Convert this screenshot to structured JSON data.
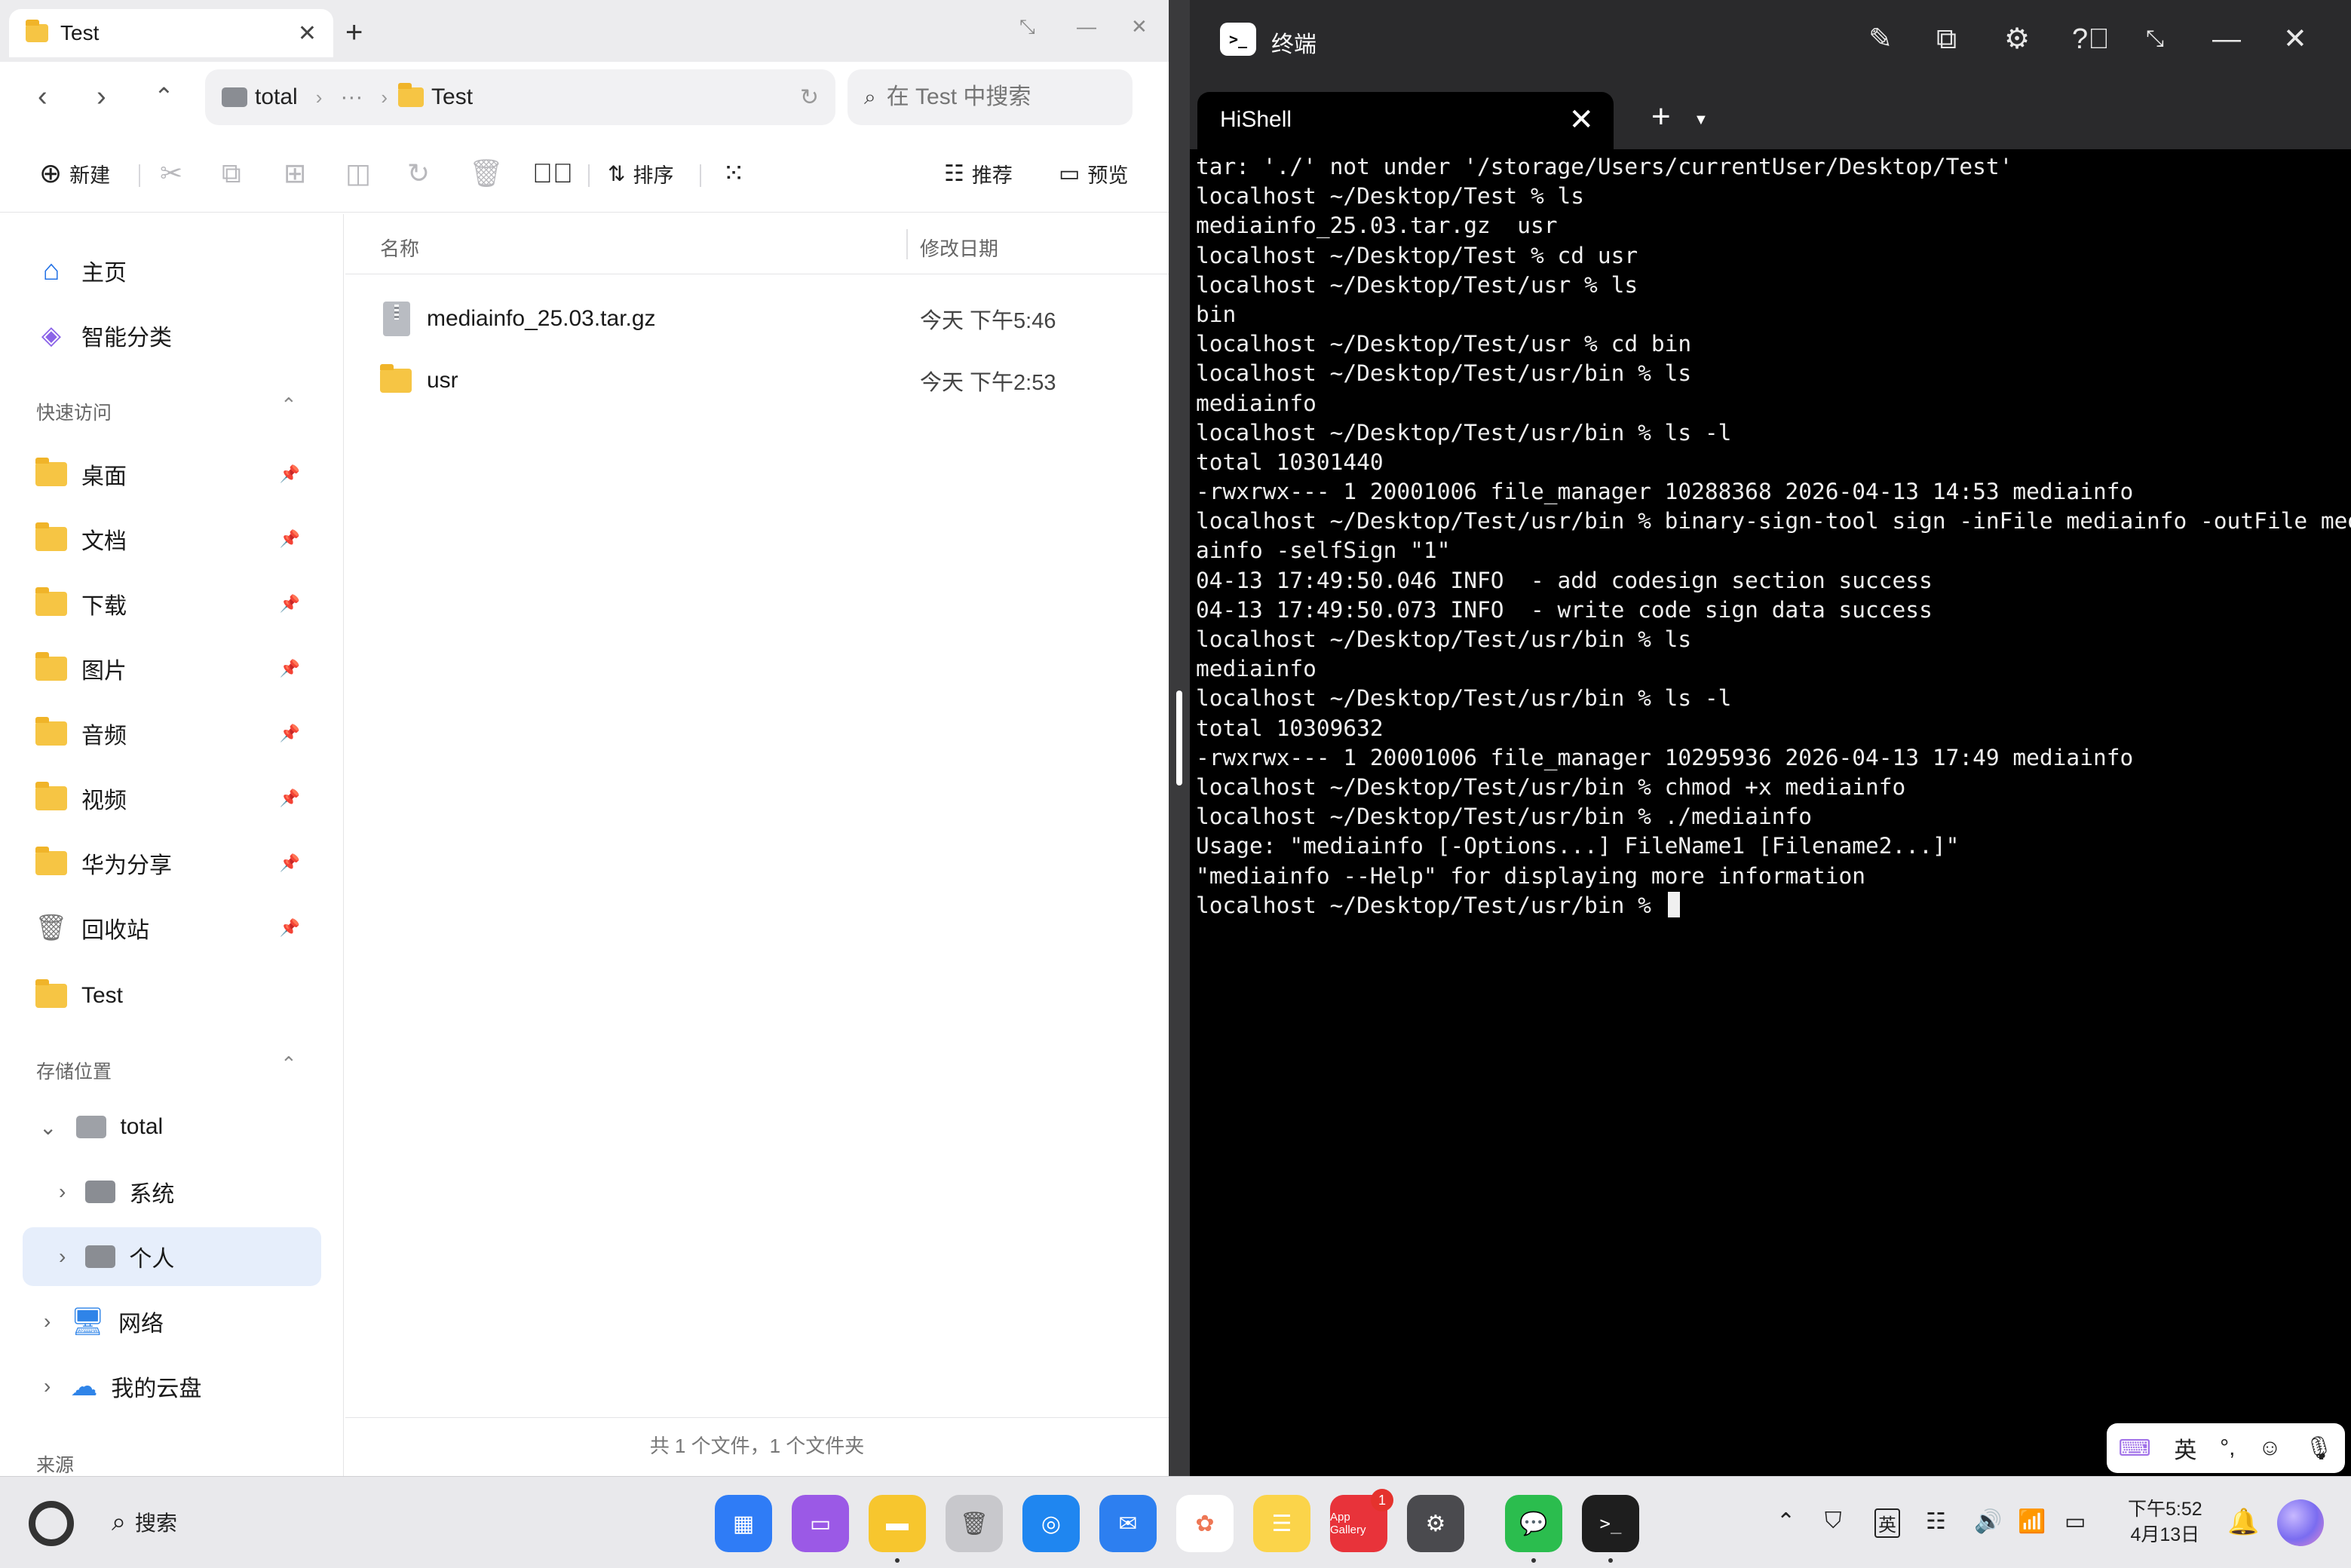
{
  "file_manager": {
    "tab_title": "Test",
    "nav": {
      "breadcrumb_root": "total",
      "breadcrumb_more": "···",
      "breadcrumb_current": "Test"
    },
    "search_placeholder": "在 Test 中搜索",
    "toolbar": {
      "new_label": "新建",
      "sort_label": "排序",
      "recommend_label": "推荐",
      "preview_label": "预览"
    },
    "sidebar": {
      "home": "主页",
      "smart": "智能分类",
      "quick_access_title": "快速访问",
      "quick_access": [
        "桌面",
        "文档",
        "下载",
        "图片",
        "音频",
        "视频",
        "华为分享",
        "回收站",
        "Test"
      ],
      "storage_title": "存储位置",
      "storage_root": "total",
      "storage_children": [
        "系统",
        "个人"
      ],
      "network": "网络",
      "cloud": "我的云盘",
      "source_title": "来源"
    },
    "columns": {
      "name": "名称",
      "modified": "修改日期"
    },
    "files": [
      {
        "name": "mediainfo_25.03.tar.gz",
        "modified": "今天 下午5:46",
        "kind": "archive"
      },
      {
        "name": "usr",
        "modified": "今天 下午2:53",
        "kind": "folder"
      }
    ],
    "status": "共 1 个文件，1 个文件夹"
  },
  "terminal": {
    "window_title": "终端",
    "tab_title": "HiShell",
    "lines": [
      "tar: './' not under '/storage/Users/currentUser/Desktop/Test'",
      "localhost ~/Desktop/Test % ls",
      "mediainfo_25.03.tar.gz  usr",
      "localhost ~/Desktop/Test % cd usr",
      "localhost ~/Desktop/Test/usr % ls",
      "bin",
      "localhost ~/Desktop/Test/usr % cd bin",
      "localhost ~/Desktop/Test/usr/bin % ls",
      "mediainfo",
      "localhost ~/Desktop/Test/usr/bin % ls -l",
      "total 10301440",
      "-rwxrwx--- 1 20001006 file_manager 10288368 2026-04-13 14:53 mediainfo",
      "localhost ~/Desktop/Test/usr/bin % binary-sign-tool sign -inFile mediainfo -outFile medi",
      "ainfo -selfSign \"1\"",
      "04-13 17:49:50.046 INFO  - add codesign section success",
      "04-13 17:49:50.073 INFO  - write code sign data success",
      "localhost ~/Desktop/Test/usr/bin % ls",
      "mediainfo",
      "localhost ~/Desktop/Test/usr/bin % ls -l",
      "total 10309632",
      "-rwxrwx--- 1 20001006 file_manager 10295936 2026-04-13 17:49 mediainfo",
      "localhost ~/Desktop/Test/usr/bin % chmod +x mediainfo",
      "localhost ~/Desktop/Test/usr/bin % ./mediainfo",
      "Usage: \"mediainfo [-Options...] FileName1 [Filename2...]\"",
      "\"mediainfo --Help\" for displaying more information"
    ],
    "prompt": "localhost ~/Desktop/Test/usr/bin % "
  },
  "ime": {
    "lang": "英"
  },
  "taskbar": {
    "search_label": "搜索",
    "appgallery_label": "App Gallery",
    "appgallery_badge": "1",
    "tray_lang": "英",
    "time": "下午5:52",
    "date": "4月13日"
  },
  "colors": {
    "folder": "#f6c544",
    "accent": "#1f6fe5",
    "terminal_bg": "#000000",
    "selection": "#e6eefb"
  }
}
